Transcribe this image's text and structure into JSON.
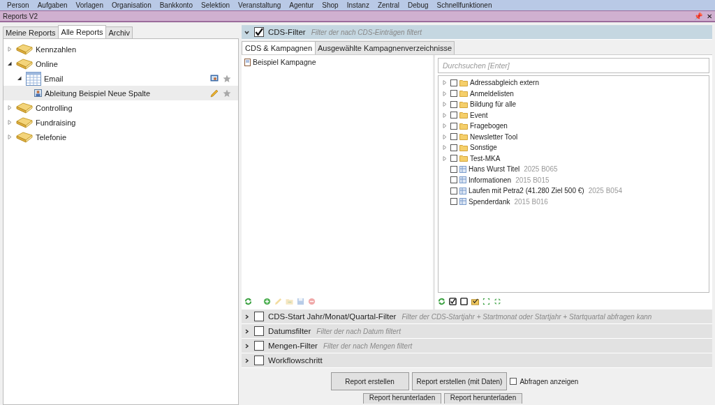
{
  "menu": [
    "Person",
    "Aufgaben",
    "Vorlagen",
    "Organisation",
    "Bankkonto",
    "Selektion",
    "Veranstaltung",
    "Agentur",
    "Shop",
    "Instanz",
    "Zentral",
    "Debug",
    "Schnellfunktionen"
  ],
  "window": {
    "title": "Reports V2",
    "pin": "📌",
    "close": "✕"
  },
  "left_tabs": [
    {
      "label": "Meine Reports",
      "selected": false
    },
    {
      "label": "Alle Reports",
      "selected": true
    },
    {
      "label": "Archiv",
      "selected": false
    }
  ],
  "report_tree": [
    {
      "label": "Kennzahlen",
      "kind": "folder",
      "expanded": false
    },
    {
      "label": "Online",
      "kind": "folder",
      "expanded": true,
      "children": [
        {
          "label": "Email",
          "kind": "table",
          "expanded": true,
          "children": [
            {
              "label": "Ableitung Beispiel Neue Spalte",
              "kind": "report",
              "selected": true
            }
          ]
        }
      ]
    },
    {
      "label": "Controlling",
      "kind": "folder",
      "expanded": false
    },
    {
      "label": "Fundraising",
      "kind": "folder",
      "expanded": false
    },
    {
      "label": "Telefonie",
      "kind": "folder",
      "expanded": false
    }
  ],
  "filters": [
    {
      "title": "CDS-Filter",
      "description": "Filter der nach CDS-Einträgen filtert",
      "checked": true,
      "expanded": true
    },
    {
      "title": "CDS-Start Jahr/Monat/Quartal-Filter",
      "description": "Filter der CDS-Startjahr + Startmonat oder Startjahr + Startquartal abfragen kann",
      "checked": false,
      "expanded": false
    },
    {
      "title": "Datumsfilter",
      "description": "Filter der nach Datum filtert",
      "checked": false,
      "expanded": false
    },
    {
      "title": "Mengen-Filter",
      "description": "Filter der nach Mengen filtert",
      "checked": false,
      "expanded": false
    },
    {
      "title": "Workflowschritt",
      "checked": false,
      "expanded": false
    }
  ],
  "cds_tabs": [
    {
      "label": "CDS & Kampagnen",
      "selected": true
    },
    {
      "label": "Ausgewählte Kampagnenverzeichnisse",
      "selected": false
    }
  ],
  "selected_campaigns": [
    "Beispiel Kampagne"
  ],
  "search": {
    "placeholder": "Durchsuchen [Enter]"
  },
  "campaign_tree": [
    {
      "label": "Adressabgleich extern",
      "kind": "folder",
      "checked": false
    },
    {
      "label": "Anmeldelisten",
      "kind": "folder",
      "checked": false
    },
    {
      "label": "Bildung für alle",
      "kind": "folder",
      "checked": false
    },
    {
      "label": "Event",
      "kind": "folder",
      "checked": false
    },
    {
      "label": "Fragebogen",
      "kind": "folder",
      "checked": false
    },
    {
      "label": "Newsletter Tool",
      "kind": "folder",
      "checked": false
    },
    {
      "label": "Sonstige",
      "kind": "folder",
      "checked": false
    },
    {
      "label": "Test-MKA",
      "kind": "folder",
      "checked": false
    },
    {
      "label": "Hans Wurst Titel",
      "kind": "campaign",
      "code": "2025 B065",
      "checked": false
    },
    {
      "label": "Informationen",
      "kind": "campaign",
      "code": "2015 B015",
      "checked": false
    },
    {
      "label": "Laufen mit Petra2 (41.280 Ziel 500 €)",
      "kind": "campaign",
      "code": "2025 B054",
      "checked": false
    },
    {
      "label": "Spenderdank",
      "kind": "campaign",
      "code": "2015 B016",
      "checked": false
    }
  ],
  "buttons": [
    "Report erstellen",
    "Report erstellen (mit Daten)"
  ],
  "show_queries": {
    "label": "Abfragen anzeigen",
    "checked": false
  },
  "buttons_row2": [
    "Report herunterladen",
    "Report herunterladen"
  ]
}
